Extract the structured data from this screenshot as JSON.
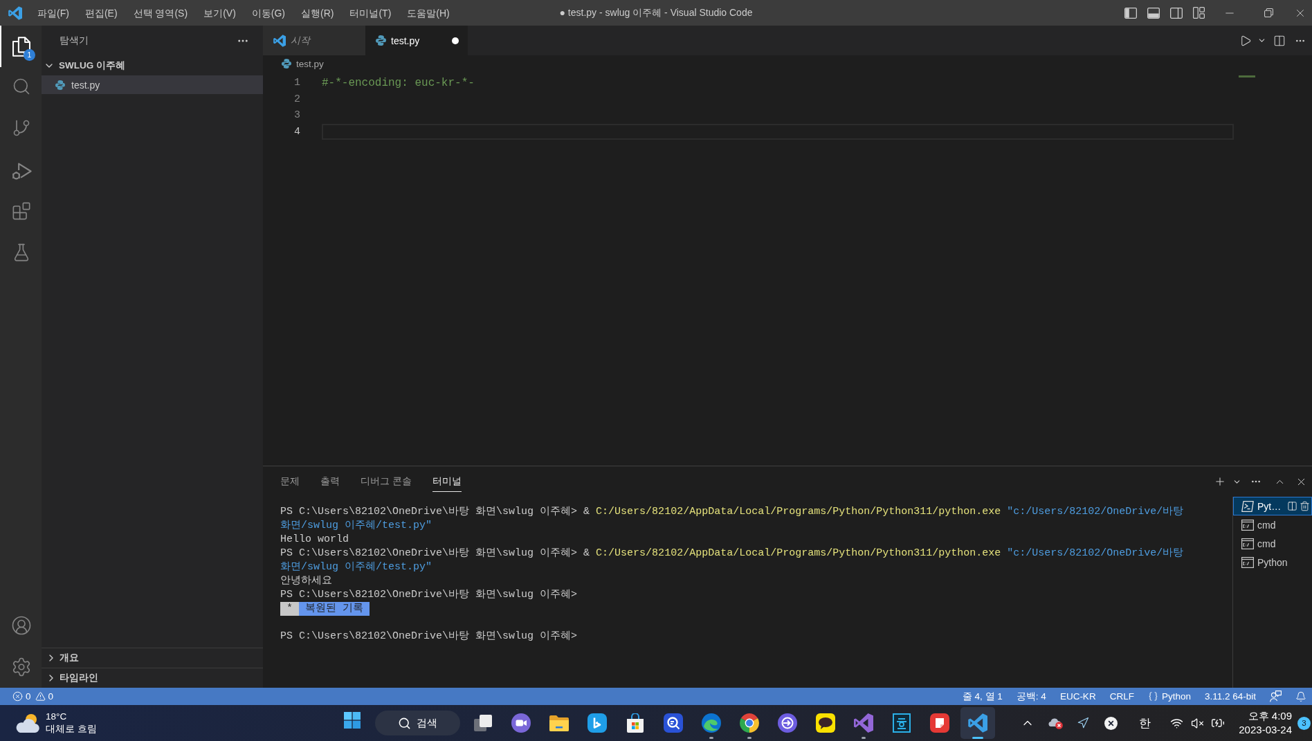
{
  "window": {
    "title": "● test.py - swlug 이주혜 - Visual Studio Code"
  },
  "menu": [
    "파일(F)",
    "편집(E)",
    "선택 영역(S)",
    "보기(V)",
    "이동(G)",
    "실행(R)",
    "터미널(T)",
    "도움말(H)"
  ],
  "layout_toggles": [
    {
      "kind": "primary-sidebar",
      "on": true
    },
    {
      "kind": "panel",
      "on": true
    },
    {
      "kind": "secondary-sidebar",
      "on": false
    }
  ],
  "activity_bar": {
    "items": [
      {
        "kind": "explorer",
        "selected": true,
        "badge": "1"
      },
      {
        "kind": "search",
        "selected": false
      },
      {
        "kind": "source-control",
        "selected": false
      },
      {
        "kind": "run-debug",
        "selected": false
      },
      {
        "kind": "extensions",
        "selected": false
      },
      {
        "kind": "testing",
        "selected": false
      }
    ],
    "bottom": [
      {
        "kind": "account"
      },
      {
        "kind": "settings"
      }
    ]
  },
  "sidebar": {
    "title": "탐색기",
    "folder": {
      "name": "SWLUG 이주혜",
      "expanded": true,
      "files": [
        {
          "name": "test.py",
          "selected": true
        }
      ]
    },
    "sections": [
      {
        "name": "개요",
        "expanded": false
      },
      {
        "name": "타임라인",
        "expanded": false
      }
    ]
  },
  "editor": {
    "tabs": [
      {
        "label": "시작",
        "kind": "welcome",
        "selected": false,
        "preview": true,
        "modified": false
      },
      {
        "label": "test.py",
        "kind": "python",
        "selected": true,
        "preview": false,
        "modified": true
      }
    ],
    "breadcrumb": "test.py",
    "lines": [
      {
        "number": "1",
        "code": "#-*-encoding: euc-kr-*-",
        "current": false
      },
      {
        "number": "2",
        "current": false
      },
      {
        "number": "3",
        "current": false
      },
      {
        "number": "4",
        "current": true
      }
    ]
  },
  "panel": {
    "tabs": [
      {
        "label": "문제",
        "selected": false
      },
      {
        "label": "출력",
        "selected": false
      },
      {
        "label": "디버그 콘솔",
        "selected": false
      },
      {
        "label": "터미널",
        "selected": true
      }
    ],
    "terminal": {
      "lines": [
        {
          "kind": "text",
          "segments": [
            {
              "kind": "prompt",
              "text": "PS C:\\Users\\82102\\OneDrive\\바탕 화면\\swlug 이주혜>"
            },
            {
              "kind": "plain",
              "text": "&"
            },
            {
              "kind": "path",
              "text": "C:/Users/82102/AppData/Local/Programs/Python/Python311/python.exe"
            },
            {
              "kind": "string",
              "text": "\"c:/Users/82102/OneDrive/바탕"
            }
          ]
        },
        {
          "kind": "text",
          "segments": [
            {
              "kind": "string",
              "text": "화면/swlug 이주혜/test.py\""
            }
          ]
        },
        {
          "kind": "text",
          "segments": [
            {
              "kind": "output",
              "text": "Hello world"
            }
          ]
        },
        {
          "kind": "text",
          "segments": [
            {
              "kind": "prompt",
              "text": "PS C:\\Users\\82102\\OneDrive\\바탕 화면\\swlug 이주혜>"
            },
            {
              "kind": "plain",
              "text": "&"
            },
            {
              "kind": "path",
              "text": "C:/Users/82102/AppData/Local/Programs/Python/Python311/python.exe"
            },
            {
              "kind": "string",
              "text": "\"c:/Users/82102/OneDrive/바탕"
            }
          ]
        },
        {
          "kind": "text",
          "segments": [
            {
              "kind": "string",
              "text": "화면/swlug 이주혜/test.py\""
            }
          ]
        },
        {
          "kind": "text",
          "segments": [
            {
              "kind": "output",
              "text": "안녕하세요"
            }
          ]
        },
        {
          "kind": "text",
          "segments": [
            {
              "kind": "prompt",
              "text": "PS C:\\Users\\82102\\OneDrive\\바탕 화면\\swlug 이주혜>"
            }
          ]
        },
        {
          "kind": "marker",
          "segments": [
            {
              "kind": "star",
              "text": "*"
            },
            {
              "kind": "label",
              "text": "복원된 기록"
            }
          ]
        },
        {
          "kind": "blank"
        },
        {
          "kind": "text",
          "segments": [
            {
              "kind": "prompt",
              "text": "PS C:\\Users\\82102\\OneDrive\\바탕 화면\\swlug 이주혜>"
            }
          ]
        }
      ]
    },
    "terminals": [
      {
        "label": "Pyt…",
        "kind": "powershell",
        "selected": true
      },
      {
        "label": "cmd",
        "kind": "cmd",
        "selected": false
      },
      {
        "label": "cmd",
        "kind": "cmd",
        "selected": false
      },
      {
        "label": "Python",
        "kind": "cmd",
        "selected": false
      }
    ]
  },
  "status_bar": {
    "errors": "0",
    "warnings": "0",
    "items": [
      {
        "kind": "text",
        "text": "줄 4, 열 1"
      },
      {
        "kind": "text",
        "text": "공백: 4"
      },
      {
        "kind": "text",
        "text": "EUC-KR"
      },
      {
        "kind": "text",
        "text": "CRLF"
      },
      {
        "kind": "language",
        "text": "Python"
      },
      {
        "kind": "text",
        "text": "3.11.2 64-bit"
      }
    ]
  },
  "taskbar": {
    "weather": {
      "temperature": "18°C",
      "condition": "대체로 흐림"
    },
    "search": {
      "placeholder": "검색"
    },
    "apps": [
      {
        "kind": "task-view",
        "running": false,
        "selected": false
      },
      {
        "kind": "video-chat",
        "running": false,
        "selected": false
      },
      {
        "kind": "files",
        "running": false,
        "selected": false
      },
      {
        "kind": "bing",
        "running": false,
        "selected": false
      },
      {
        "kind": "store",
        "running": false,
        "selected": false
      },
      {
        "kind": "magnifier",
        "running": false,
        "selected": false
      },
      {
        "kind": "edge",
        "running": true,
        "selected": false
      },
      {
        "kind": "chrome",
        "running": true,
        "selected": false
      },
      {
        "kind": "arrow",
        "running": false,
        "selected": false
      },
      {
        "kind": "kakao",
        "running": false,
        "selected": false
      },
      {
        "kind": "visual-studio",
        "running": true,
        "selected": false
      },
      {
        "kind": "hangul",
        "running": false,
        "selected": false
      },
      {
        "kind": "note",
        "running": false,
        "selected": false
      },
      {
        "kind": "vscode",
        "running": true,
        "selected": true
      }
    ],
    "tray": {
      "ime": "한",
      "time": "오후 4:09",
      "date": "2023-03-24",
      "notifications": "3"
    }
  }
}
